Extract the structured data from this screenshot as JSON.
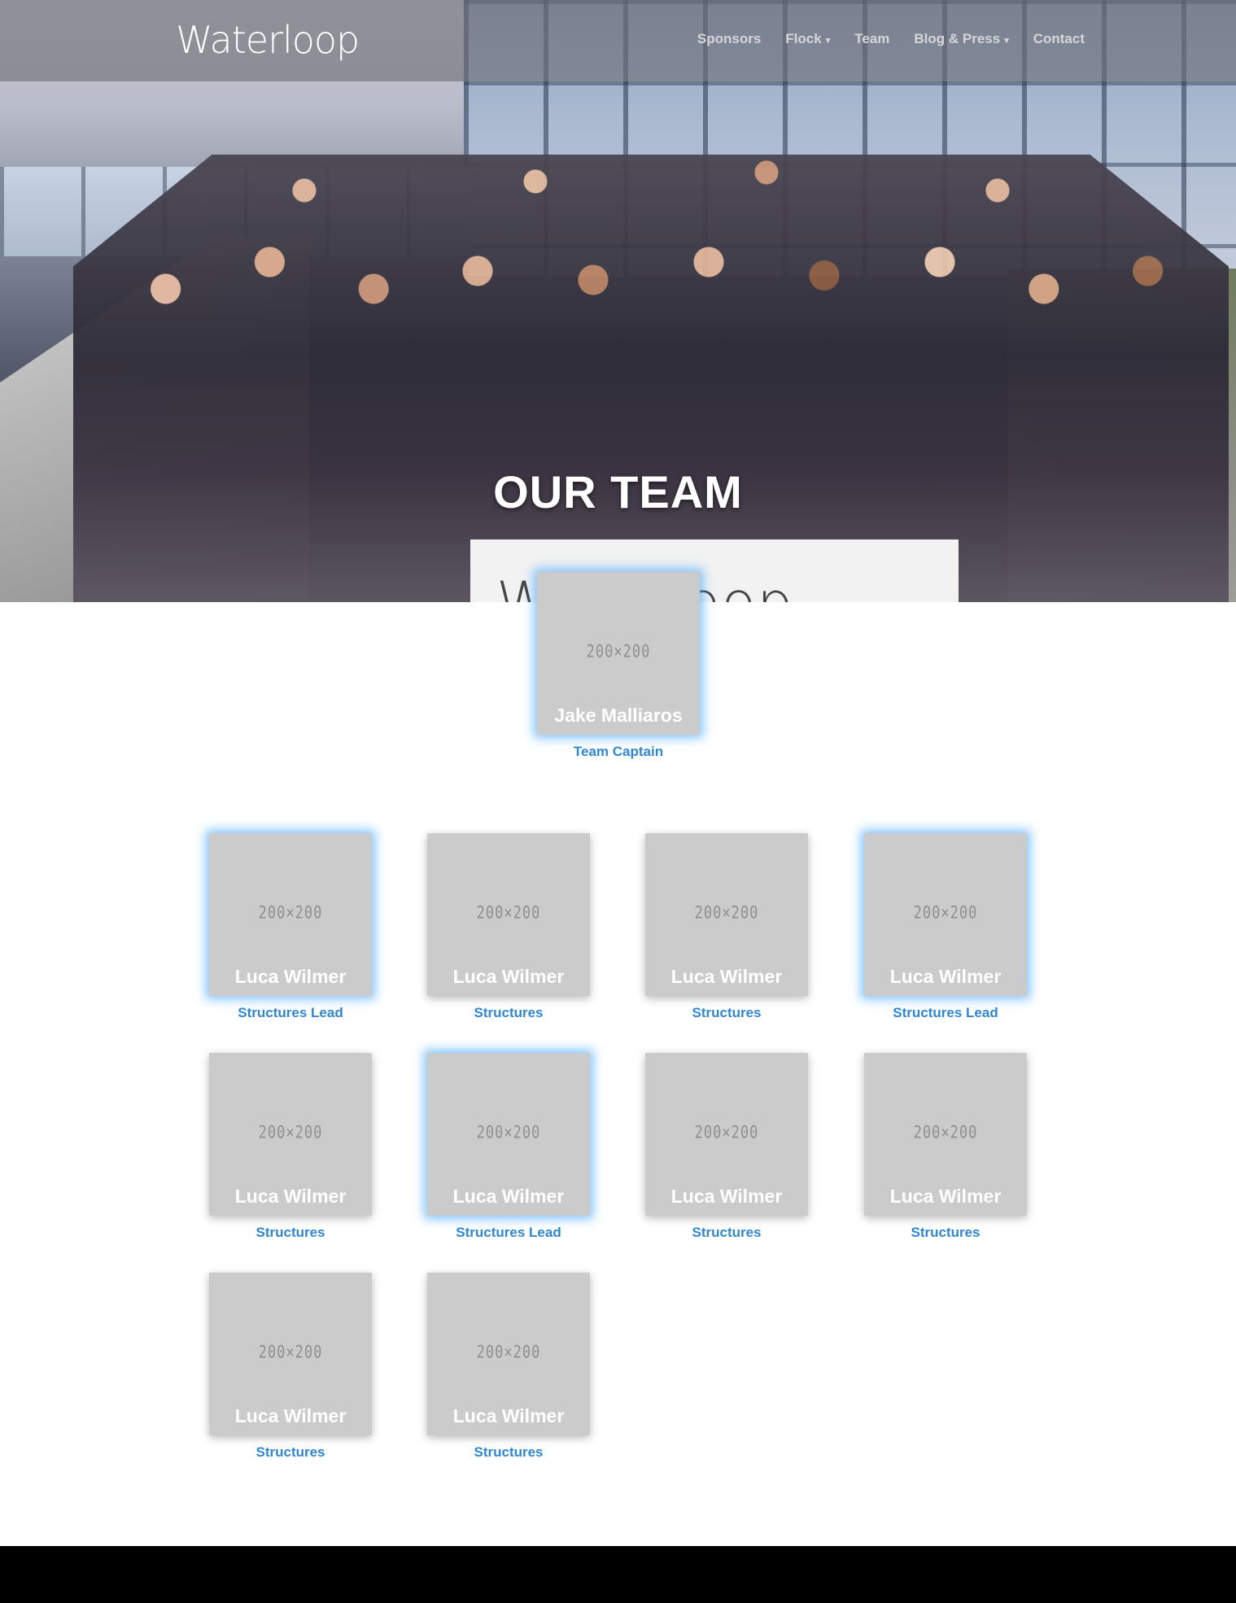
{
  "brand": {
    "logo_text": "Waterloop"
  },
  "nav": {
    "items": [
      {
        "label": "Sponsors",
        "dropdown": false
      },
      {
        "label": "Flock",
        "dropdown": true
      },
      {
        "label": "Team",
        "dropdown": false
      },
      {
        "label": "Blog & Press",
        "dropdown": true
      },
      {
        "label": "Contact",
        "dropdown": false
      }
    ],
    "caret": "▾"
  },
  "hero": {
    "title": "OUR TEAM",
    "banner_text": "Waterloop"
  },
  "placeholder_text": "200×200",
  "captain": {
    "name": "Jake Malliaros",
    "role": "Team Captain"
  },
  "members": [
    {
      "name": "Luca Wilmer",
      "role": "Structures Lead"
    },
    {
      "name": "Luca Wilmer",
      "role": "Structures"
    },
    {
      "name": "Luca Wilmer",
      "role": "Structures"
    },
    {
      "name": "Luca Wilmer",
      "role": "Structures Lead"
    },
    {
      "name": "Luca Wilmer",
      "role": "Structures"
    },
    {
      "name": "Luca Wilmer",
      "role": "Structures Lead"
    },
    {
      "name": "Luca Wilmer",
      "role": "Structures"
    },
    {
      "name": "Luca Wilmer",
      "role": "Structures"
    },
    {
      "name": "Luca Wilmer",
      "role": "Structures"
    },
    {
      "name": "Luca Wilmer",
      "role": "Structures"
    }
  ],
  "colors": {
    "accent": "#2f86d1",
    "glow": "#41a5ff",
    "card_bg": "#cbcbcb",
    "footer": "#000000"
  }
}
